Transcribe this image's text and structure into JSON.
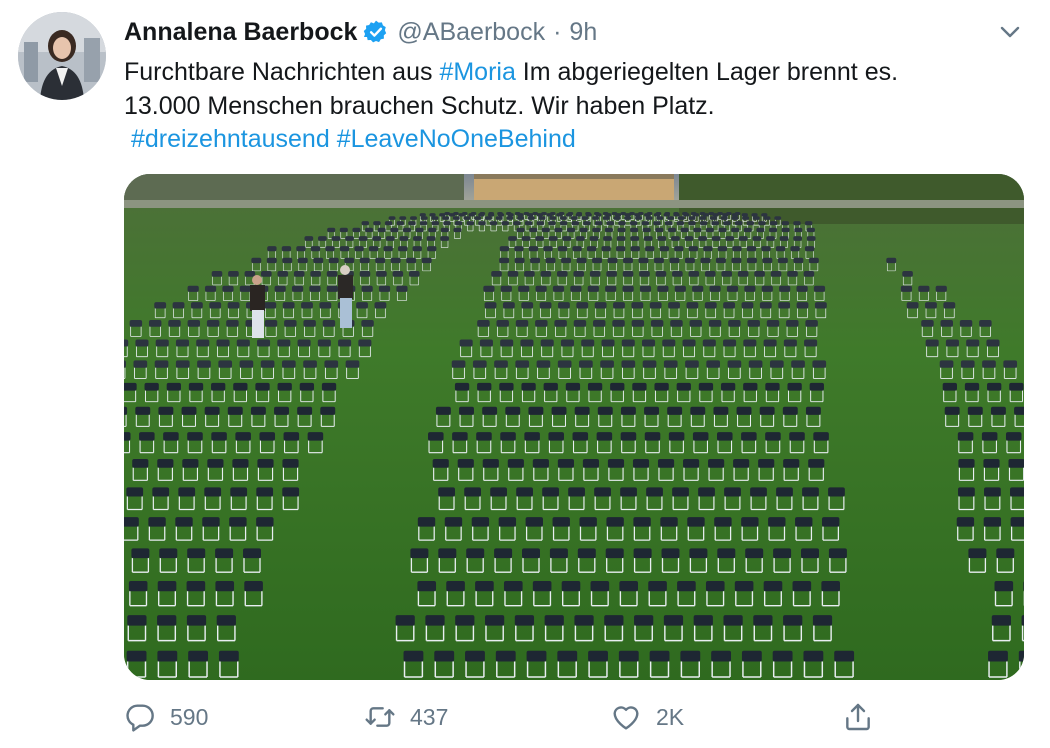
{
  "tweet": {
    "author": {
      "name": "Annalena Baerbock",
      "handle": "@ABaerbock",
      "separator": "·",
      "time": "9h",
      "verified": true
    },
    "text": {
      "line1_pre": "Furchtbare Nachrichten aus ",
      "hashtag_moria": "#Moria",
      "line1_post": " Im abgeriegelten Lager brennt es.",
      "line2": "13.000 Menschen brauchen Schutz. Wir haben Platz.",
      "hashtag_dreizehntausend": "#dreizehntausend",
      "hashtag_leavenoonebehind": "#LeaveNoOneBehind"
    },
    "media": {
      "description_icon": "photo"
    },
    "actions": {
      "reply_count": "590",
      "retweet_count": "437",
      "like_count": "2K"
    },
    "colors": {
      "link": "#1b95e0",
      "secondary": "#657786",
      "verified": "#1da1f2"
    }
  }
}
